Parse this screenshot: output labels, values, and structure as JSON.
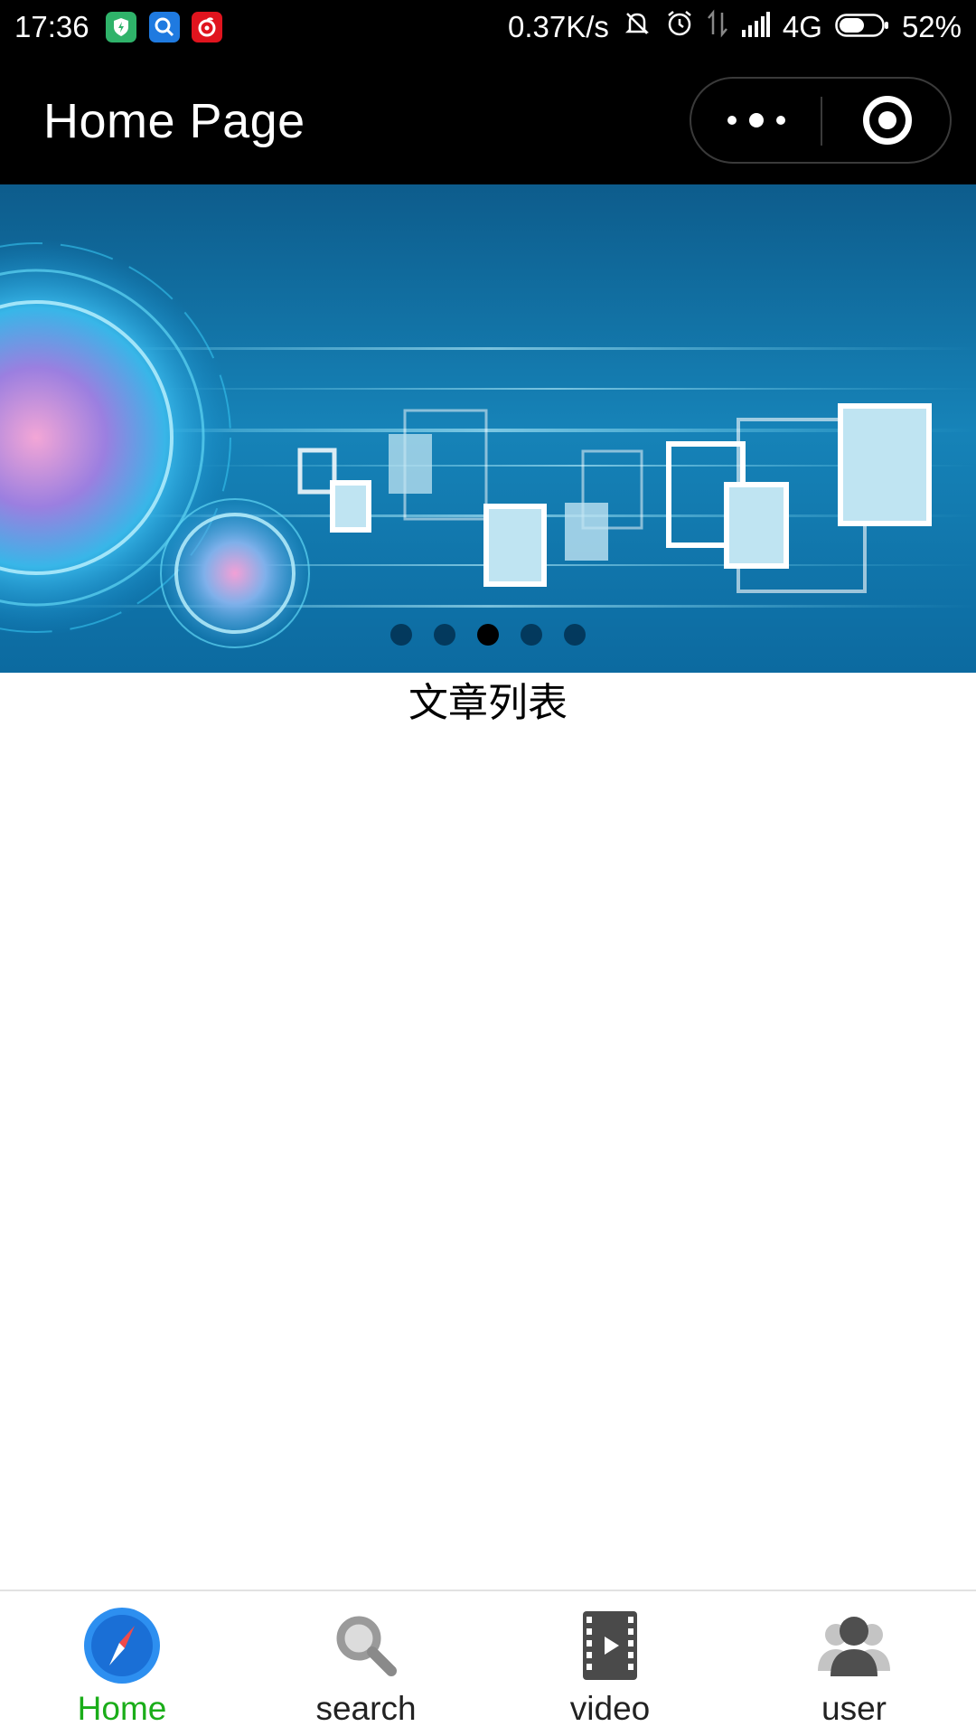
{
  "status_bar": {
    "time": "17:36",
    "net_speed": "0.37K/s",
    "network": "4G",
    "battery": "52%",
    "icons": [
      "shield-app-icon",
      "search-app-icon",
      "netease-music-icon",
      "mute-icon",
      "alarm-icon",
      "data-arrows-icon",
      "signal-icon",
      "battery-icon"
    ]
  },
  "title_bar": {
    "title": "Home Page"
  },
  "banner": {
    "slide_count": 5,
    "active_index": 2
  },
  "main": {
    "section_title": "文章列表"
  },
  "tab_bar": {
    "active_color": "#1aad19",
    "tabs": [
      {
        "label": "Home",
        "icon": "compass-icon",
        "active": true
      },
      {
        "label": "search",
        "icon": "search-icon",
        "active": false
      },
      {
        "label": "video",
        "icon": "video-icon",
        "active": false
      },
      {
        "label": "user",
        "icon": "user-icon",
        "active": false
      }
    ]
  }
}
